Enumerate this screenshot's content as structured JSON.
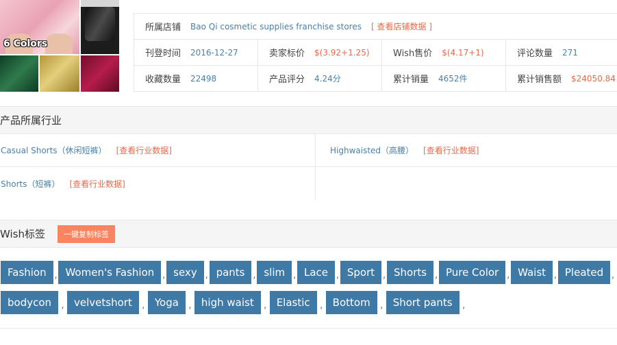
{
  "product_image": {
    "colors_label": "6 Colors"
  },
  "info": {
    "store": {
      "label": "所属店铺",
      "value": "Bao Qi cosmetic supplies franchise stores",
      "link": "[ 查看店铺数据 ]"
    },
    "listed": {
      "label": "刊登时间",
      "value": "2016-12-27"
    },
    "seller_price": {
      "label": "卖家标价",
      "value": "$(3.92+1.25)"
    },
    "wish_price": {
      "label": "Wish售价",
      "value": "$(4.17+1)"
    },
    "reviews": {
      "label": "评论数量",
      "value": "271"
    },
    "favorites": {
      "label": "收藏数量",
      "value": "22498"
    },
    "rating": {
      "label": "产品评分",
      "value": "4.24分"
    },
    "sales": {
      "label": "累计销量",
      "value": "4652件"
    },
    "revenue": {
      "label": "累计销售额",
      "value": "$24050.84"
    }
  },
  "industry": {
    "title": "产品所属行业",
    "link_label": "[查看行业数据]",
    "items": [
      {
        "name": "Casual Shorts（休闲短裤）"
      },
      {
        "name": "Highwaisted（高腰）"
      },
      {
        "name": "Shorts（短裤）"
      }
    ]
  },
  "wish_tags": {
    "title": "Wish标签",
    "copy_button": "一键复制标签",
    "separator": ",",
    "row1": [
      "Fashion",
      "Women's Fashion",
      "sexy",
      "pants",
      "slim",
      "Lace",
      "Sport",
      "Shorts",
      "Pure Color",
      "Waist",
      "Pleated"
    ],
    "row2": [
      "bodycon",
      "velvetshort",
      "Yoga",
      "high waist",
      "Elastic",
      "Bottom",
      "Short pants"
    ]
  },
  "colors": {
    "link_red": "#e8684a",
    "value_blue": "#4a7fa8",
    "tag_blue": "#3f7aa6",
    "button_orange": "#f9845f"
  }
}
